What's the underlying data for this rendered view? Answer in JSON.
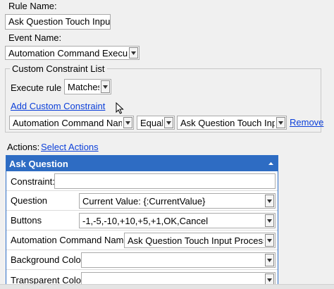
{
  "rule": {
    "rule_name_label": "Rule Name:",
    "rule_name_value": "Ask Question Touch Input",
    "event_name_label": "Event Name:",
    "event_name_value": "Automation Command Executed"
  },
  "constraints": {
    "group_title": "Custom Constraint List",
    "execute_label": "Execute rule if",
    "execute_value": "Matches",
    "add_link": "Add Custom Constraint",
    "field_value": "Automation Command Name",
    "operator_value": "Equals",
    "match_value": "Ask Question Touch Input",
    "remove_link": "Remove"
  },
  "actions": {
    "label": "Actions:",
    "select_link": "Select Actions",
    "panel_title": "Ask Question",
    "constraint_label": "Constraint:",
    "constraint_value": "",
    "rows": [
      {
        "label": "Question",
        "value": "Current Value: {:CurrentValue}"
      },
      {
        "label": "Buttons",
        "value": "-1,-5,-10,+10,+5,+1,OK,Cancel"
      },
      {
        "label": "Automation Command Name",
        "value": "Ask Question Touch Input Processing"
      },
      {
        "label": "Background Color",
        "value": ""
      },
      {
        "label": "Transparent Color",
        "value": ""
      }
    ]
  }
}
